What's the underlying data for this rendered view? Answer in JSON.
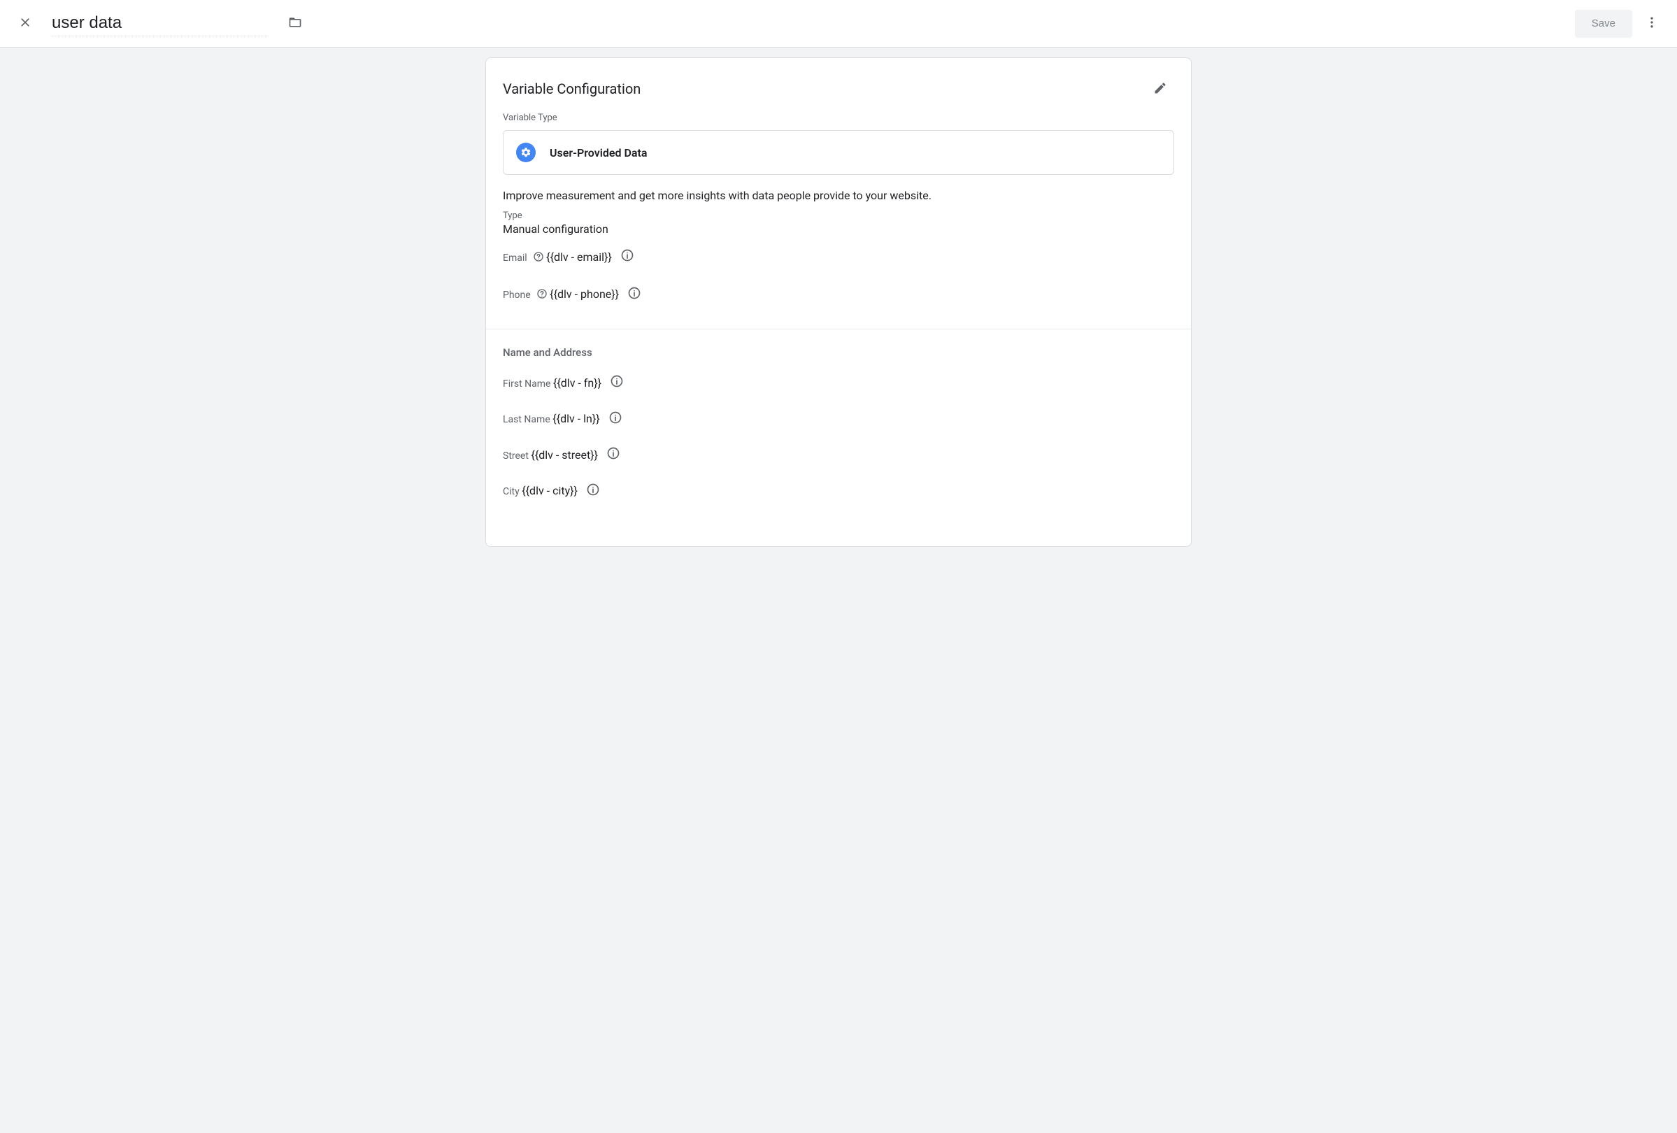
{
  "topbar": {
    "title": "user data",
    "save": "Save"
  },
  "card": {
    "title": "Variable Configuration",
    "variable_type_label": "Variable Type",
    "variable_type_name": "User-Provided Data",
    "description": "Improve measurement and get more insights with data people provide to your website.",
    "type": {
      "label": "Type",
      "value": "Manual configuration"
    },
    "fields": {
      "email": {
        "label": "Email",
        "value": "{{dlv - email}}"
      },
      "phone": {
        "label": "Phone",
        "value": "{{dlv - phone}}"
      },
      "first": {
        "label": "First Name",
        "value": "{{dlv - fn}}"
      },
      "last": {
        "label": "Last Name",
        "value": "{{dlv - ln}}"
      },
      "street": {
        "label": "Street",
        "value": "{{dlv - street}}"
      },
      "city": {
        "label": "City",
        "value": "{{dlv - city}}"
      }
    },
    "group_heading": "Name and Address"
  }
}
